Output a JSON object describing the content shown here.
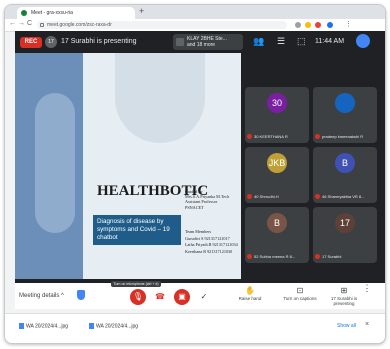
{
  "browser": {
    "tab_title": "Meet - gra-xxsu-ria",
    "new_tab": "+",
    "url": "meet.google.com/zsc-raxa-dr",
    "back": "←",
    "forward": "→",
    "reload": "C"
  },
  "meet": {
    "rec_label": "REC",
    "presenter_avatar": "17",
    "presenting_text": "17 Surabhi is presenting",
    "others_text": "KLAY 2BHE Ste...",
    "others_sub": "and 18 more",
    "clock": "11:44 AM",
    "people_icon": "people-icon",
    "chat_icon": "chat-icon"
  },
  "slide": {
    "title": "HEALTHBOTIC",
    "guide_lines": [
      "Guided by",
      "Mrs.S.A.Priyanka M.Tech",
      "Assistant Professor",
      "PSNACET"
    ],
    "team_lines": [
      "Team Members",
      "Gurudivi S     921317121017",
      "Latha Priyadi.R 921317121034",
      "Keerthana R     921317121030"
    ],
    "box_text": "Diagnosis of disease by symptoms and Covid – 19 chatbot"
  },
  "tiles": [
    {
      "avatar": "30",
      "name": "30 KEERTHANA R",
      "color": "#7b1fa2"
    },
    {
      "avatar": "",
      "name": "pradeep kmeenakshi R",
      "color": "#1565c0"
    },
    {
      "avatar": "JKB",
      "name": "40 Shrrudhi.H",
      "color": "#c0a036"
    },
    {
      "avatar": "B",
      "name": "46 Sharmyaktha VR 8...",
      "color": "#3f51b5"
    },
    {
      "avatar": "B",
      "name": "52 Subha meena R 8...",
      "color": "#795548"
    },
    {
      "avatar": "17",
      "name": "17 Surabhi",
      "color": "#5d4037"
    }
  ],
  "controls": {
    "meeting_details": "Meeting details",
    "meeting_details_chevron": "^",
    "mic_tooltip": "Turn on microphone (ctrl + d)",
    "mic_icon": "mic-off-icon",
    "hangup_icon": "hangup-icon",
    "cam_icon": "camera-off-icon",
    "check": "✓",
    "raise_hand": "Raise hand",
    "captions": "Turn on captions",
    "presenting_label": "17 Surabhi is presenting",
    "more": "⋮"
  },
  "downloads": [
    {
      "name": "WA 20/2024/4...jpg"
    },
    {
      "name": "WA 20/2024/4...jpg"
    }
  ],
  "downloads_show_all": "Show all",
  "downloads_close": "×"
}
